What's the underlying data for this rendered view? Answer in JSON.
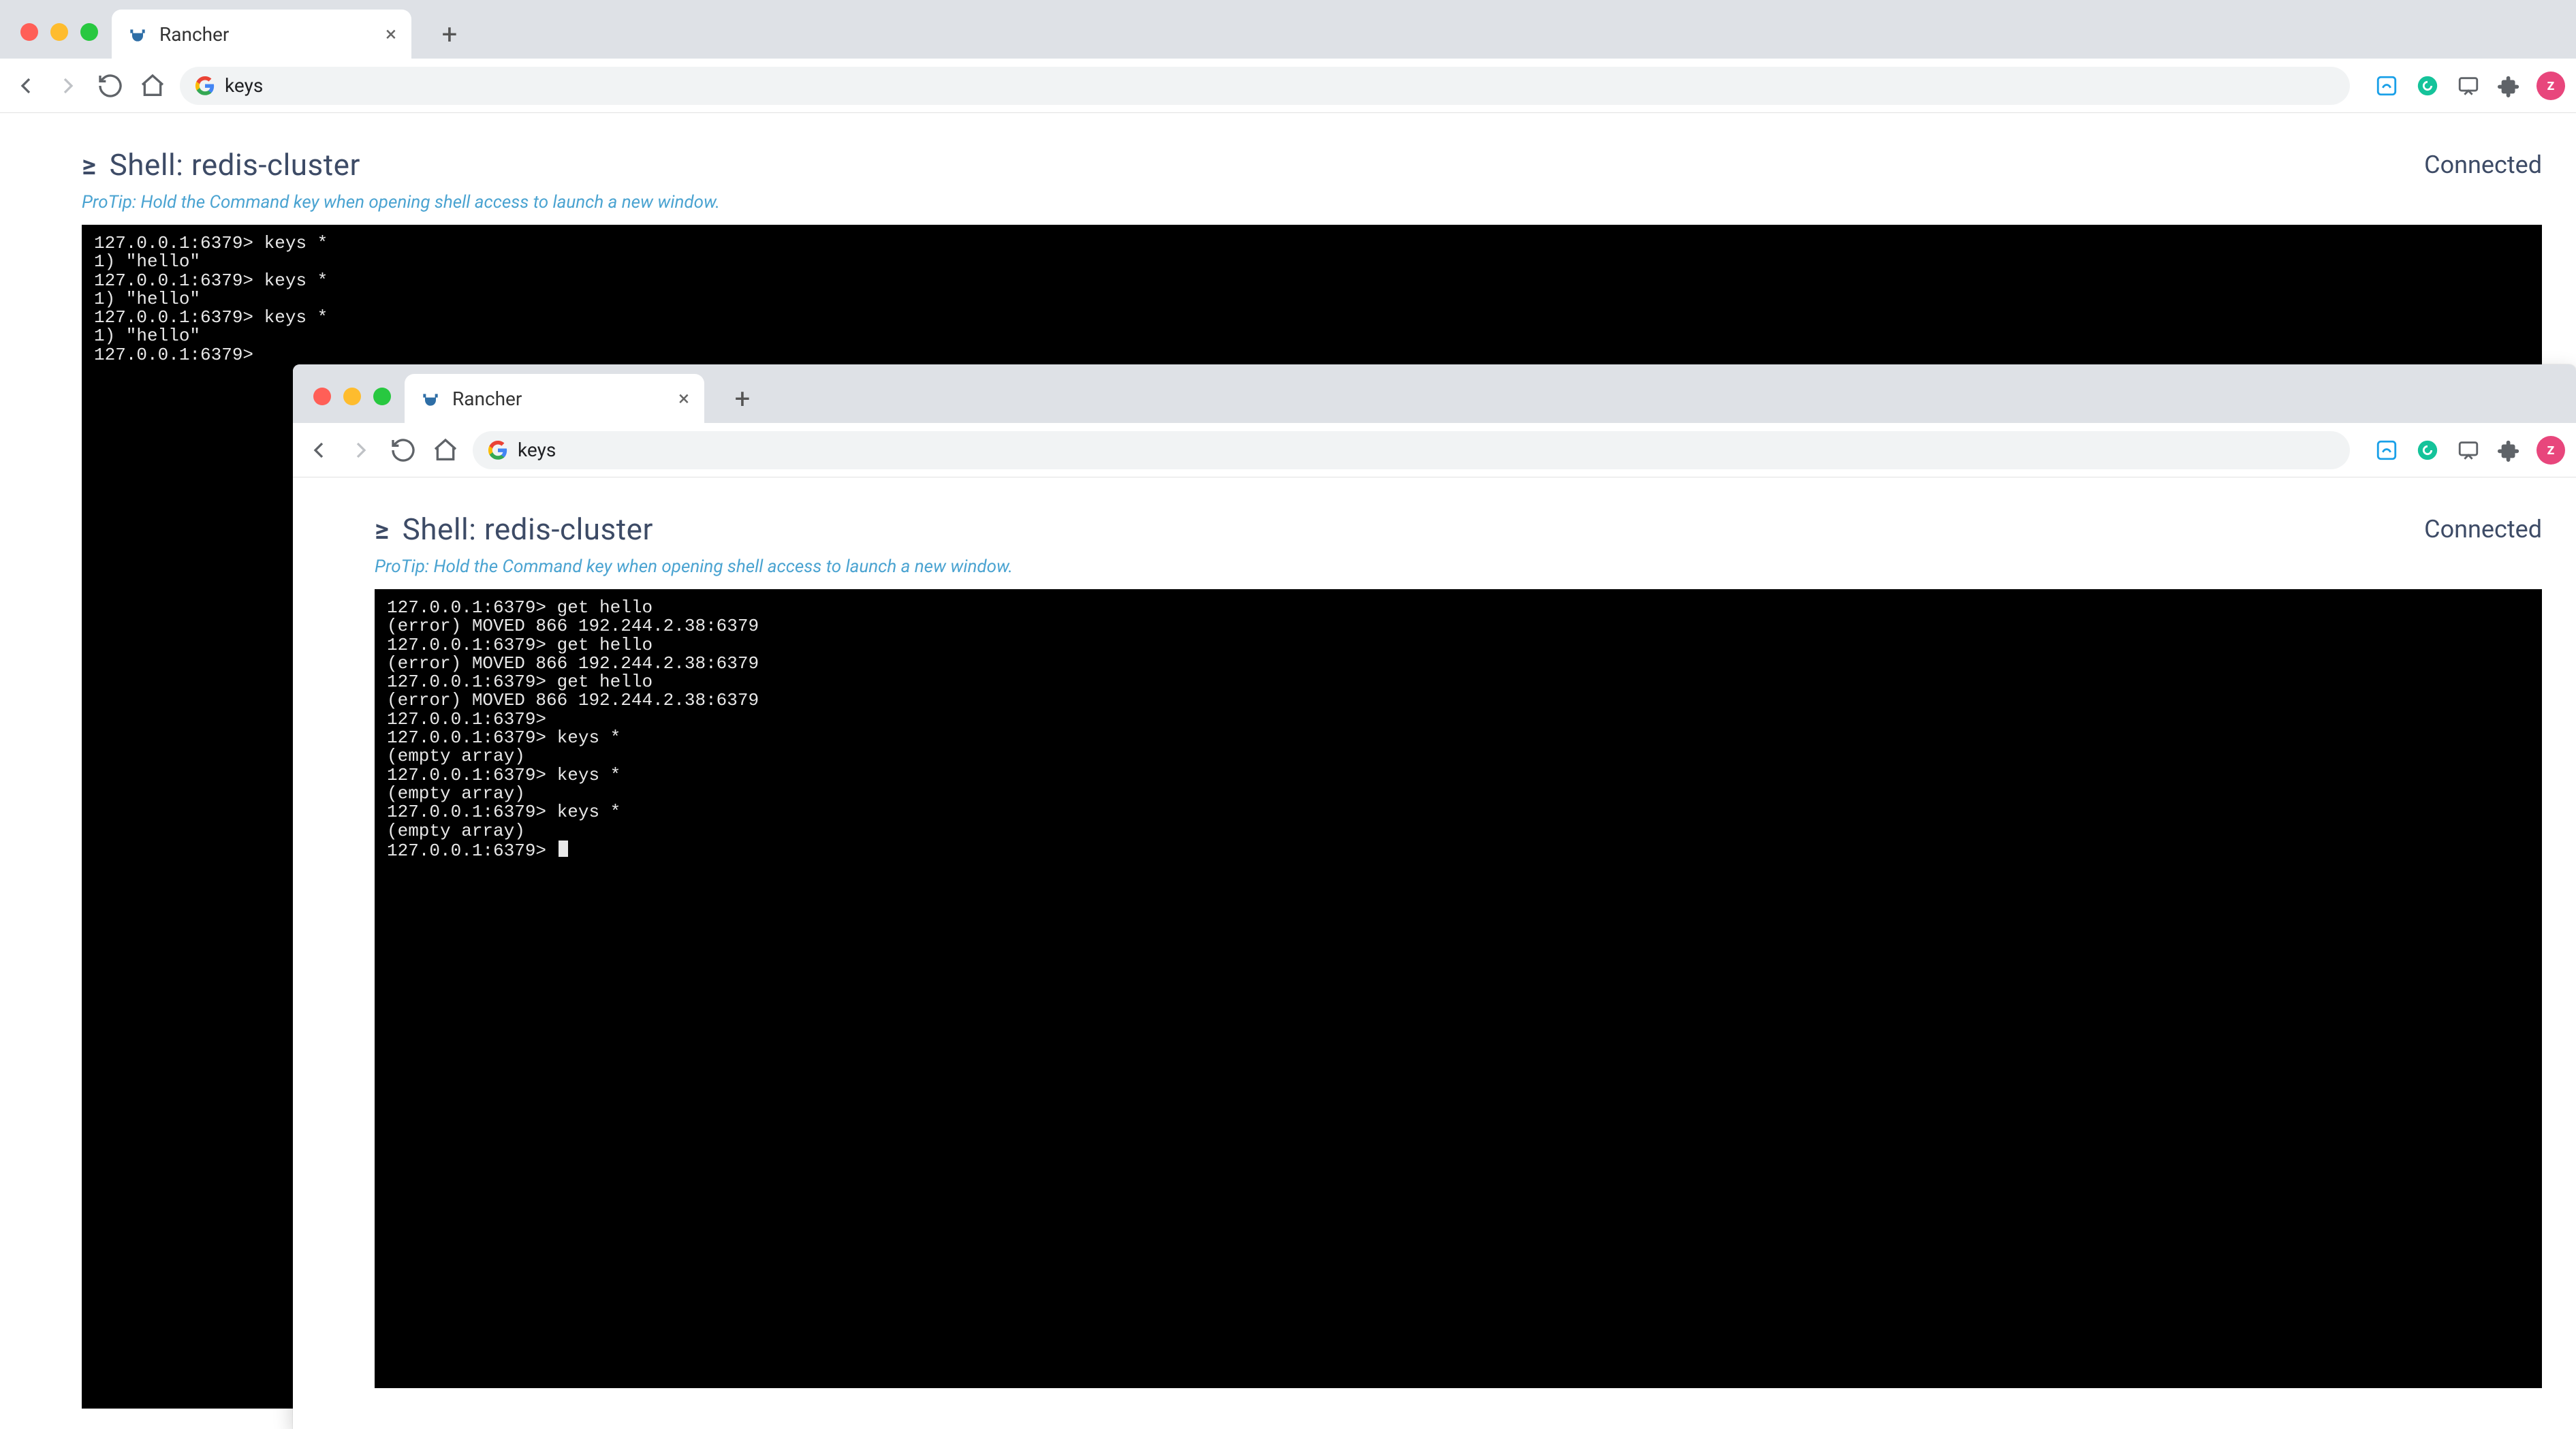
{
  "windows": {
    "back": {
      "tab_title": "Rancher",
      "omnibox_text": "keys",
      "shell_title": "Shell: redis-cluster",
      "status": "Connected",
      "protip": "ProTip: Hold the Command key when opening shell access to launch a new window.",
      "terminal_lines": [
        "127.0.0.1:6379> keys *",
        "1) \"hello\"",
        "127.0.0.1:6379> keys *",
        "1) \"hello\"",
        "127.0.0.1:6379> keys *",
        "1) \"hello\"",
        "127.0.0.1:6379>"
      ]
    },
    "front": {
      "tab_title": "Rancher",
      "omnibox_text": "keys",
      "shell_title": "Shell: redis-cluster",
      "status": "Connected",
      "protip": "ProTip: Hold the Command key when opening shell access to launch a new window.",
      "terminal_lines": [
        "127.0.0.1:6379> get hello",
        "(error) MOVED 866 192.244.2.38:6379",
        "127.0.0.1:6379> get hello",
        "(error) MOVED 866 192.244.2.38:6379",
        "127.0.0.1:6379> get hello",
        "(error) MOVED 866 192.244.2.38:6379",
        "127.0.0.1:6379>",
        "127.0.0.1:6379> keys *",
        "(empty array)",
        "127.0.0.1:6379> keys *",
        "(empty array)",
        "127.0.0.1:6379> keys *",
        "(empty array)",
        "127.0.0.1:6379> "
      ]
    }
  },
  "avatar_initial": "z",
  "colors": {
    "terminal_bg": "#000000",
    "terminal_fg": "#e8e8e8",
    "protip": "#4aa3d1",
    "heading": "#3d4b66"
  }
}
